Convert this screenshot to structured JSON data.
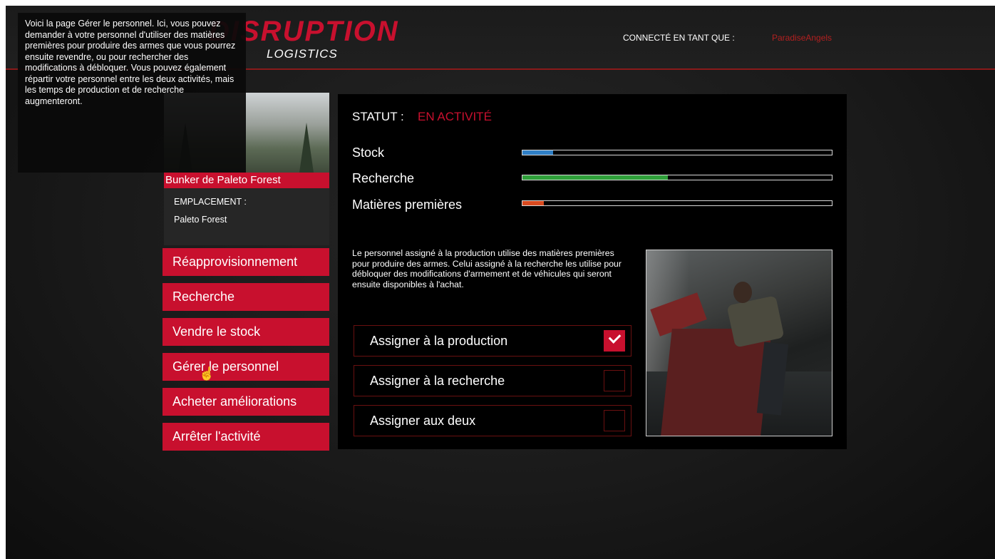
{
  "tooltip": {
    "text": "Voici la page Gérer le personnel. Ici, vous pouvez demander à votre personnel d'utiliser des matières premières pour produire des armes que vous pourrez ensuite revendre, ou pour rechercher des modifications à débloquer. Vous pouvez également répartir votre personnel entre les deux activités, mais les temps de production et de recherche augmenteront."
  },
  "header": {
    "logo_main": "DISRUPTION",
    "logo_sub": "LOGISTICS",
    "login_label": "CONNECTÉ EN TANT QUE :",
    "login_user": "ParadiseAngels"
  },
  "location": {
    "name": "Bunker de Paleto Forest",
    "label": "EMPLACEMENT :",
    "value": "Paleto Forest"
  },
  "menu": {
    "items": [
      {
        "label": "Réapprovisionnement"
      },
      {
        "label": "Recherche"
      },
      {
        "label": "Vendre le stock"
      },
      {
        "label": "Gérer le personnel"
      },
      {
        "label": "Acheter améliorations"
      },
      {
        "label": "Arrêter l'activité"
      }
    ]
  },
  "status": {
    "label": "STATUT :",
    "value": "EN ACTIVITÉ"
  },
  "bars": [
    {
      "label": "Stock",
      "fraction": 0.1,
      "color": "#2f7fc6"
    },
    {
      "label": "Recherche",
      "fraction": 0.47,
      "color": "#2fa03a"
    },
    {
      "label": "Matières premières",
      "fraction": 0.07,
      "color": "#d94a1f"
    }
  ],
  "description": "Le personnel assigné à la production utilise des matières premières pour produire des armes. Celui assigné à la recherche les utilise pour débloquer des modifications d'armement et de véhicules qui seront ensuite disponibles à l'achat.",
  "assignments": [
    {
      "label": "Assigner à la production",
      "checked": true
    },
    {
      "label": "Assigner à la recherche",
      "checked": false
    },
    {
      "label": "Assigner aux deux",
      "checked": false
    }
  ],
  "colors": {
    "accent": "#c8102e"
  },
  "icons": {
    "cursor": "hand-pointer-icon",
    "check": "checkmark-icon"
  }
}
